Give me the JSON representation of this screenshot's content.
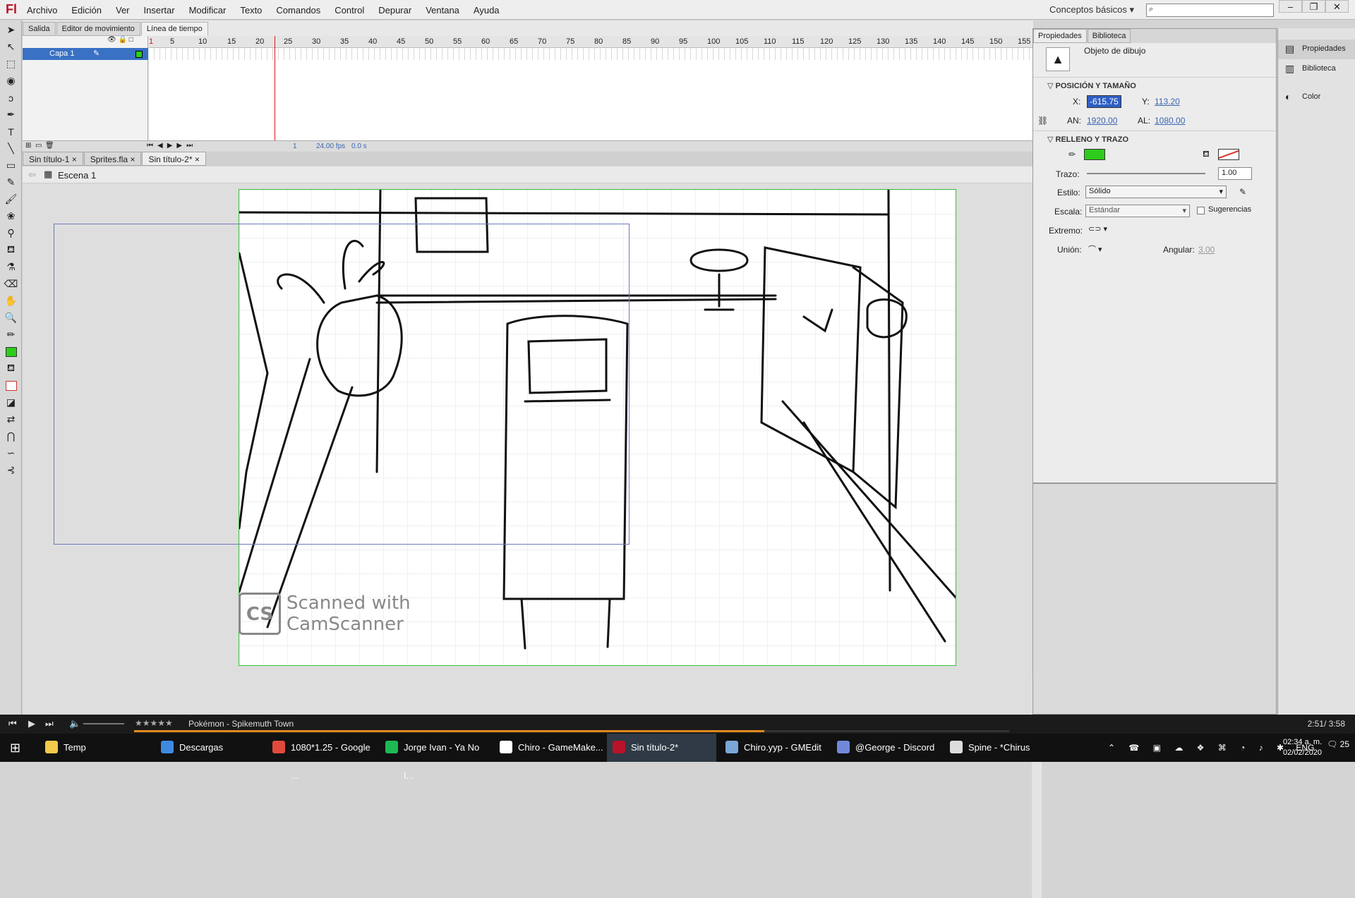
{
  "app": {
    "logo": "Fl"
  },
  "menu": [
    "Archivo",
    "Edición",
    "Ver",
    "Insertar",
    "Modificar",
    "Texto",
    "Comandos",
    "Control",
    "Depurar",
    "Ventana",
    "Ayuda"
  ],
  "workspace": "Conceptos básicos",
  "window_controls": [
    "–",
    "❐",
    "✕"
  ],
  "timeline": {
    "tabs": [
      "Salida",
      "Editor de movimiento",
      "Línea de tiempo"
    ],
    "layer_name": "Capa 1",
    "ruler_ticks": [
      "1",
      "5",
      "10",
      "15",
      "20",
      "25",
      "30",
      "35",
      "40",
      "45",
      "50",
      "55",
      "60",
      "65",
      "70",
      "75",
      "80",
      "85",
      "90",
      "95",
      "100",
      "105",
      "110",
      "115",
      "120",
      "125",
      "130",
      "135",
      "140",
      "145",
      "150",
      "155"
    ],
    "current_frame": "1",
    "fps": "24.00 fps",
    "time": "0.0 s"
  },
  "doc_tabs": [
    "Sin título-1",
    "Sprites.fla",
    "Sin título-2*"
  ],
  "breadcrumb": "Escena 1",
  "stage": {
    "watermark_line1": "Scanned with",
    "watermark_line2": "CamScanner",
    "watermark_logo": "CS"
  },
  "properties": {
    "tabs": [
      "Propiedades",
      "Biblioteca"
    ],
    "object_type": "Objeto de dibujo",
    "section_pos": "POSICIÓN Y TAMAÑO",
    "x_label": "X:",
    "x_value": "-615.75",
    "y_label": "Y:",
    "y_value": "113.20",
    "w_label": "AN:",
    "w_value": "1920.00",
    "h_label": "AL:",
    "h_value": "1080.00",
    "section_fill": "RELLENO Y TRAZO",
    "fill_color": "#2ecc1a",
    "stroke_label": "Trazo:",
    "stroke_value": "1.00",
    "style_label": "Estilo:",
    "style_value": "Sólido",
    "scale_label": "Escala:",
    "scale_value": "Estándar",
    "hints_label": "Sugerencias",
    "cap_label": "Extremo:",
    "join_label": "Unión:",
    "angular_label": "Angular:",
    "angular_value": "3.00"
  },
  "right_dock": [
    "Propiedades",
    "Biblioteca",
    "Color"
  ],
  "media": {
    "song": "Pokémon - Spikemuth Town",
    "stars": "★★★★★",
    "time": "2:51/ 3:58",
    "progress": 0.72
  },
  "taskbar": [
    {
      "label": "Temp",
      "color": "#f3c94a"
    },
    {
      "label": "Descargas",
      "color": "#3d8ae0"
    },
    {
      "label": "1080*1.25 - Google ...",
      "color": "#e04a3d"
    },
    {
      "label": "Jorge Ivan - Ya No I...",
      "color": "#1db954"
    },
    {
      "label": "Chiro - GameMake...",
      "color": "#ffffff"
    },
    {
      "label": "Sin título-2*",
      "color": "#b8132a"
    },
    {
      "label": "Chiro.yyp - GMEdit",
      "color": "#7aa7d8"
    },
    {
      "label": "@George - Discord",
      "color": "#7289da"
    },
    {
      "label": "Spine - *Chirus",
      "color": "#dddddd"
    }
  ],
  "tray": {
    "lang": "ENG",
    "time": "02:34 a. m.",
    "date": "02/02/2020",
    "notifications": "25"
  }
}
